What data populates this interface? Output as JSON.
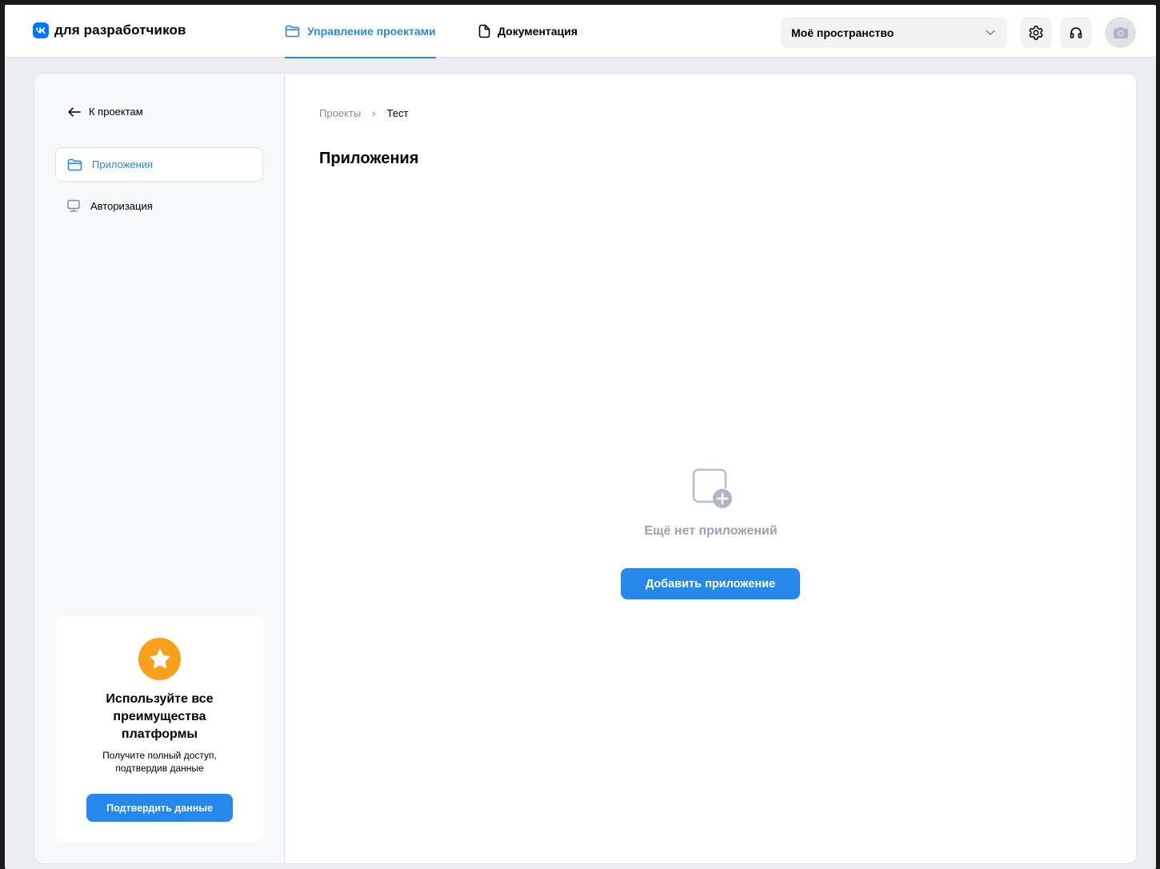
{
  "header": {
    "logo_text": "для разработчиков",
    "tabs": [
      {
        "label": "Управление проектами",
        "icon": "folder-icon",
        "active": true
      },
      {
        "label": "Документация",
        "icon": "document-icon",
        "active": false
      }
    ],
    "workspace_select": {
      "value": "Моё пространство"
    },
    "icons": [
      "gear-icon",
      "headset-icon",
      "camera-icon"
    ]
  },
  "sidebar": {
    "back_label": "К проектам",
    "items": [
      {
        "label": "Приложения",
        "icon": "folder-icon",
        "active": true
      },
      {
        "label": "Авторизация",
        "icon": "monitor-icon",
        "active": false
      }
    ],
    "promo": {
      "title": "Используйте все преимущества платформы",
      "subtitle": "Получите полный доступ, подтвердив данные",
      "button_label": "Подтвердить данные"
    }
  },
  "main": {
    "breadcrumb": {
      "parent": "Проекты",
      "separator": "›",
      "current": "Тест"
    },
    "title": "Приложения",
    "empty_state": {
      "icon": "add-app-icon",
      "text": "Ещё нет приложений",
      "button_label": "Добавить приложение"
    }
  },
  "colors": {
    "accent": "#2688eb",
    "vk_brand": "#0077ff",
    "promo_star": "#f8a01c",
    "muted_text": "#99a2ad",
    "breadcrumb_link": "#818c99"
  }
}
